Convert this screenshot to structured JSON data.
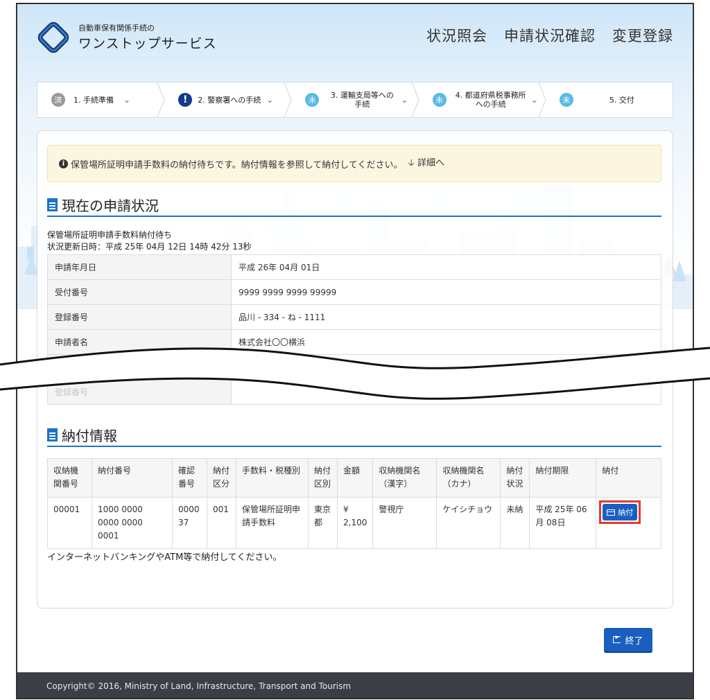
{
  "brand": {
    "small": "自動車保有関係手続の",
    "large": "ワンストップサービス"
  },
  "topnav": [
    "状況照会",
    "申請状況確認",
    "変更登録"
  ],
  "steps": [
    {
      "badge": "済",
      "label": "1. 手続準備",
      "state": "done",
      "chevron": true
    },
    {
      "badge": "!",
      "label": "2. 警察署への手続",
      "state": "alert",
      "chevron": true
    },
    {
      "badge": "未",
      "label": "3. 運輸支局等への手続",
      "state": "pending",
      "chevron": true
    },
    {
      "badge": "未",
      "label": "4. 都道府県税事務所への手続",
      "state": "pending",
      "chevron": true
    },
    {
      "badge": "未",
      "label": "5. 交付",
      "state": "pending",
      "chevron": false
    }
  ],
  "alert": {
    "message": "保管場所証明申請手数料の納付待ちです。納付情報を参照して納付してください。",
    "link": "詳細へ"
  },
  "current_status": {
    "title": "現在の申請状況",
    "status": "保管場所証明申請手数料納付待ち",
    "updated": "状況更新日時：平成 25年 04月 12日 14時 42分 13秒",
    "rows": [
      {
        "key": "申請年月日",
        "value": "平成 26年 04月 01日"
      },
      {
        "key": "受付番号",
        "value": "9999 9999 9999 99999"
      },
      {
        "key": "登録番号",
        "value": "品川 - 334 - ね - 1111"
      },
      {
        "key": "申請者名",
        "value": "株式会社〇〇横浜"
      },
      {
        "key": "",
        "value": ""
      },
      {
        "key": "登録番号",
        "value": ""
      }
    ]
  },
  "payment": {
    "title": "納付情報",
    "headers": [
      "収納機関番号",
      "納付番号",
      "確認番号",
      "納付区分",
      "手数料・税種別",
      "納付区別",
      "金額",
      "収納機関名（漢字）",
      "収納機関名（カナ）",
      "納付状況",
      "納付期限",
      "納付"
    ],
    "row": [
      "00001",
      "1000 0000 0000 0000 0001",
      "000037",
      "001",
      "保管場所証明申請手数料",
      "東京都",
      "¥ 2,100",
      "警視庁",
      "ケイシチョウ",
      "未納",
      "平成 25年 06月 08日"
    ],
    "pay_button": "納付",
    "note": "インターネットバンキングやATM等で納付してください。"
  },
  "end_button": "終了",
  "footer": "Copyright© 2016, Ministry of Land, Infrastructure, Transport and Tourism",
  "colors": {
    "accent": "#1a73c9",
    "button": "#1a5fbf",
    "highlight": "#e23a2b",
    "footer": "#3b3f45"
  }
}
